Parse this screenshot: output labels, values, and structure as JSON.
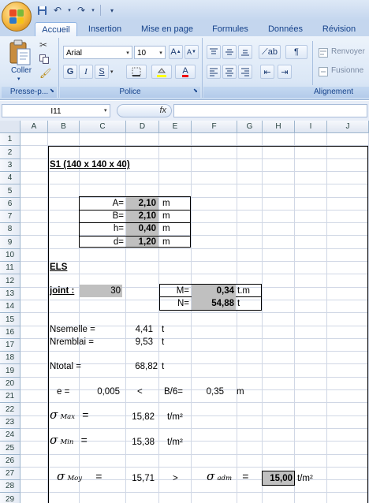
{
  "app": {
    "quick_access": [
      "save-icon",
      "undo-icon",
      "redo-icon",
      "customize-icon"
    ]
  },
  "tabs": [
    "Accueil",
    "Insertion",
    "Mise en page",
    "Formules",
    "Données",
    "Révision"
  ],
  "ribbon": {
    "paste_label": "Coller",
    "clipboard_group": "Presse-p...",
    "font_group": "Police",
    "alignment_group": "Alignement",
    "font_name": "Arial",
    "font_size": "10",
    "wrap_label": "Renvoyer",
    "merge_label": "Fusionne",
    "bold": "G",
    "italic": "I",
    "underline": "S"
  },
  "formula_bar": {
    "name_box": "I11",
    "fx": "fx",
    "content": ""
  },
  "columns": [
    "A",
    "B",
    "C",
    "D",
    "E",
    "F",
    "G",
    "H",
    "I",
    "J"
  ],
  "rows": [
    "1",
    "2",
    "3",
    "4",
    "5",
    "6",
    "7",
    "8",
    "9",
    "10",
    "11",
    "12",
    "13",
    "14",
    "15",
    "16",
    "17",
    "18",
    "19",
    "20",
    "21",
    "22",
    "23",
    "24",
    "25",
    "26",
    "27",
    "28",
    "29"
  ],
  "sheet": {
    "title": "S1 (140 x 140 x 40)",
    "dims": [
      {
        "label": "A=",
        "value": "2,10",
        "unit": "m"
      },
      {
        "label": "B=",
        "value": "2,10",
        "unit": "m"
      },
      {
        "label": "h=",
        "value": "0,40",
        "unit": "m"
      },
      {
        "label": "d=",
        "value": "1,20",
        "unit": "m"
      }
    ],
    "els": "ELS",
    "joint_label": "joint :",
    "joint_value": "30",
    "m_label": "M=",
    "m_value": "0,34",
    "m_unit": "t.m",
    "n_label": "N=",
    "n_value": "54,88",
    "n_unit": "t",
    "nsemelle_label": "Nsemelle =",
    "nsemelle_value": "4,41",
    "nsemelle_unit": "t",
    "nremblai_label": "Nremblai =",
    "nremblai_value": "9,53",
    "nremblai_unit": "t",
    "ntotal_label": "Ntotal =",
    "ntotal_value": "68,82",
    "ntotal_unit": "t",
    "e_label": "e =",
    "e_value": "0,005",
    "lt": "<",
    "b6_label": "B/6=",
    "b6_value": "0,35",
    "b6_unit": "m",
    "sigma": "σ",
    "max_sub": "Max",
    "min_sub": "Min",
    "moy_sub": "Moy",
    "adm_sub": "adm",
    "eq": "=",
    "smax_value": "15,82",
    "smin_value": "15,38",
    "smoy_value": "15,71",
    "stress_unit": "t/m²",
    "gt": ">",
    "sadm_value": "15,00"
  }
}
